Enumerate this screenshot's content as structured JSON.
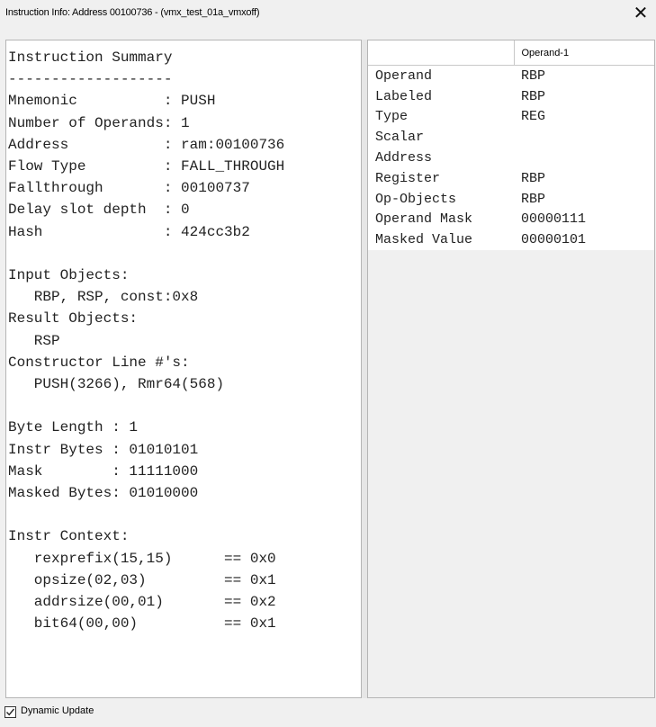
{
  "window": {
    "title": "Instruction Info: Address 00100736 - (vmx_test_01a_vmxoff)",
    "close_label": "✕"
  },
  "summary_lines": [
    "Instruction Summary",
    "-------------------",
    "Mnemonic          : PUSH",
    "Number of Operands: 1",
    "Address           : ram:00100736",
    "Flow Type         : FALL_THROUGH",
    "Fallthrough       : 00100737",
    "Delay slot depth  : 0",
    "Hash              : 424cc3b2",
    "",
    "Input Objects:",
    "   RBP, RSP, const:0x8",
    "Result Objects:",
    "   RSP",
    "Constructor Line #'s:",
    "   PUSH(3266), Rmr64(568)",
    "",
    "Byte Length : 1",
    "Instr Bytes : 01010101",
    "Mask        : 11111000",
    "Masked Bytes: 01010000",
    "",
    "Instr Context:",
    "   rexprefix(15,15)      == 0x0",
    "   opsize(02,03)         == 0x1",
    "   addrsize(00,01)       == 0x2",
    "   bit64(00,00)          == 0x1"
  ],
  "operand_table": {
    "columns": [
      "",
      "Operand-1"
    ],
    "rows": [
      {
        "name": "Operand",
        "value": "RBP"
      },
      {
        "name": "Labeled",
        "value": "RBP"
      },
      {
        "name": "Type",
        "value": "REG"
      },
      {
        "name": "Scalar",
        "value": ""
      },
      {
        "name": "Address",
        "value": ""
      },
      {
        "name": "Register",
        "value": "RBP"
      },
      {
        "name": "Op-Objects",
        "value": "RBP"
      },
      {
        "name": "Operand Mask",
        "value": "00000111"
      },
      {
        "name": "Masked Value",
        "value": "00000101"
      }
    ]
  },
  "footer": {
    "dynamic_update_label": "Dynamic Update",
    "dynamic_update_checked": true
  }
}
